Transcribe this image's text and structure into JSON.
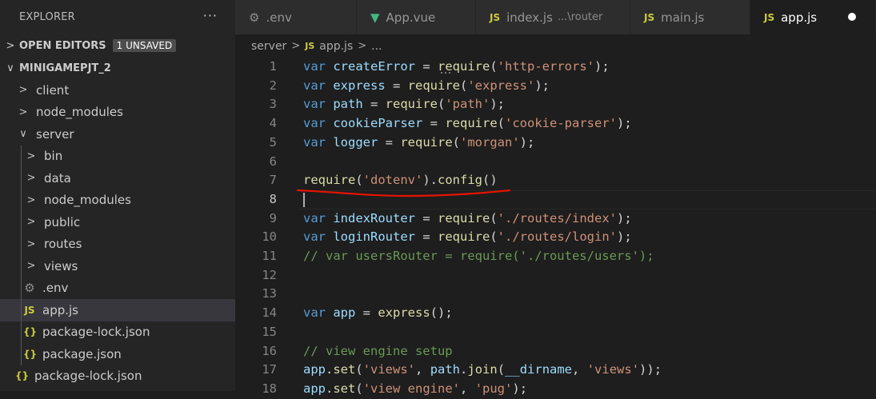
{
  "sidebar": {
    "title": "EXPLORER",
    "more_icon": "ellipsis-icon",
    "open_editors": {
      "label": "OPEN EDITORS",
      "badge": "1 UNSAVED"
    },
    "project": {
      "label": "MINIGAMEPJT_2"
    },
    "tree": [
      {
        "label": "client",
        "type": "folder",
        "state": "collapsed"
      },
      {
        "label": "node_modules",
        "type": "folder",
        "state": "collapsed"
      },
      {
        "label": "server",
        "type": "folder",
        "state": "expanded"
      },
      {
        "label": "bin",
        "type": "folder",
        "state": "collapsed"
      },
      {
        "label": "data",
        "type": "folder",
        "state": "collapsed"
      },
      {
        "label": "node_modules",
        "type": "folder",
        "state": "collapsed"
      },
      {
        "label": "public",
        "type": "folder",
        "state": "collapsed"
      },
      {
        "label": "routes",
        "type": "folder",
        "state": "collapsed"
      },
      {
        "label": "views",
        "type": "folder",
        "state": "collapsed"
      },
      {
        "label": ".env",
        "type": "file",
        "icon": "gear-icon"
      },
      {
        "label": "app.js",
        "type": "file",
        "icon_text": "JS",
        "selected": true
      },
      {
        "label": "package-lock.json",
        "type": "file",
        "icon_text": "{}"
      },
      {
        "label": "package.json",
        "type": "file",
        "icon_text": "{}"
      },
      {
        "label": "package-lock.json",
        "type": "file",
        "icon_text": "{}"
      }
    ]
  },
  "tabs": [
    {
      "label": ".env",
      "icon": "gear-icon"
    },
    {
      "label": "App.vue",
      "icon": "vue-icon"
    },
    {
      "label": "index.js",
      "icon_text": "JS",
      "description": "...\\router"
    },
    {
      "label": "main.js",
      "icon_text": "JS"
    },
    {
      "label": "app.js",
      "icon_text": "JS",
      "active": true,
      "unsaved": true
    }
  ],
  "breadcrumb": {
    "folder": "server",
    "file_icon_text": "JS",
    "file": "app.js",
    "tail": "..."
  },
  "code": {
    "line_numbers": [
      "1",
      "2",
      "3",
      "4",
      "5",
      "6",
      "7",
      "8",
      "9",
      "10",
      "11",
      "12",
      "13",
      "14",
      "15",
      "16",
      "17",
      "18"
    ],
    "lines": {
      "l1": {
        "a": "var",
        "b": " createError ",
        "c": "= ",
        "d": "require",
        "e": "(",
        "f": "'http-errors'",
        "g": ");"
      },
      "l2": {
        "a": "var",
        "b": " express ",
        "c": "= ",
        "d": "require",
        "e": "(",
        "f": "'express'",
        "g": ");"
      },
      "l3": {
        "a": "var",
        "b": " path ",
        "c": "= ",
        "d": "require",
        "e": "(",
        "f": "'path'",
        "g": ");"
      },
      "l4": {
        "a": "var",
        "b": " cookieParser ",
        "c": "= ",
        "d": "require",
        "e": "(",
        "f": "'cookie-parser'",
        "g": ");"
      },
      "l5": {
        "a": "var",
        "b": " logger ",
        "c": "= ",
        "d": "require",
        "e": "(",
        "f": "'morgan'",
        "g": ");"
      },
      "l7": {
        "a": "require",
        "b": "(",
        "c": "'dotenv'",
        "d": ").",
        "e": "config",
        "f": "()"
      },
      "l9": {
        "a": "var",
        "b": " indexRouter ",
        "c": "= ",
        "d": "require",
        "e": "(",
        "f": "'./routes/index'",
        "g": ");"
      },
      "l10": {
        "a": "var",
        "b": " loginRouter ",
        "c": "= ",
        "d": "require",
        "e": "(",
        "f": "'./routes/login'",
        "g": ");"
      },
      "l11": {
        "a": "// var usersRouter = require('./routes/users');"
      },
      "l14": {
        "a": "var",
        "b": " app ",
        "c": "= ",
        "d": "express",
        "e": "();"
      },
      "l16": {
        "a": "// view engine setup"
      },
      "l17": {
        "a": "app",
        "b": ".",
        "c": "set",
        "d": "(",
        "e": "'views'",
        "f": ", ",
        "g": "path",
        "h": ".",
        "i": "join",
        "j": "(",
        "k": "__dirname",
        "l": ", ",
        "m": "'views'",
        "n": "));"
      },
      "l18": {
        "a": "app",
        "b": ".",
        "c": "set",
        "d": "(",
        "e": "'view engine'",
        "f": ", ",
        "g": "'pug'",
        "h": ");"
      }
    }
  },
  "colors": {
    "keyword": "#569cd6",
    "variable": "#9cdcfe",
    "function": "#dcdcaa",
    "string": "#ce9178",
    "comment": "#6a9955",
    "annotation": "#e51400"
  }
}
